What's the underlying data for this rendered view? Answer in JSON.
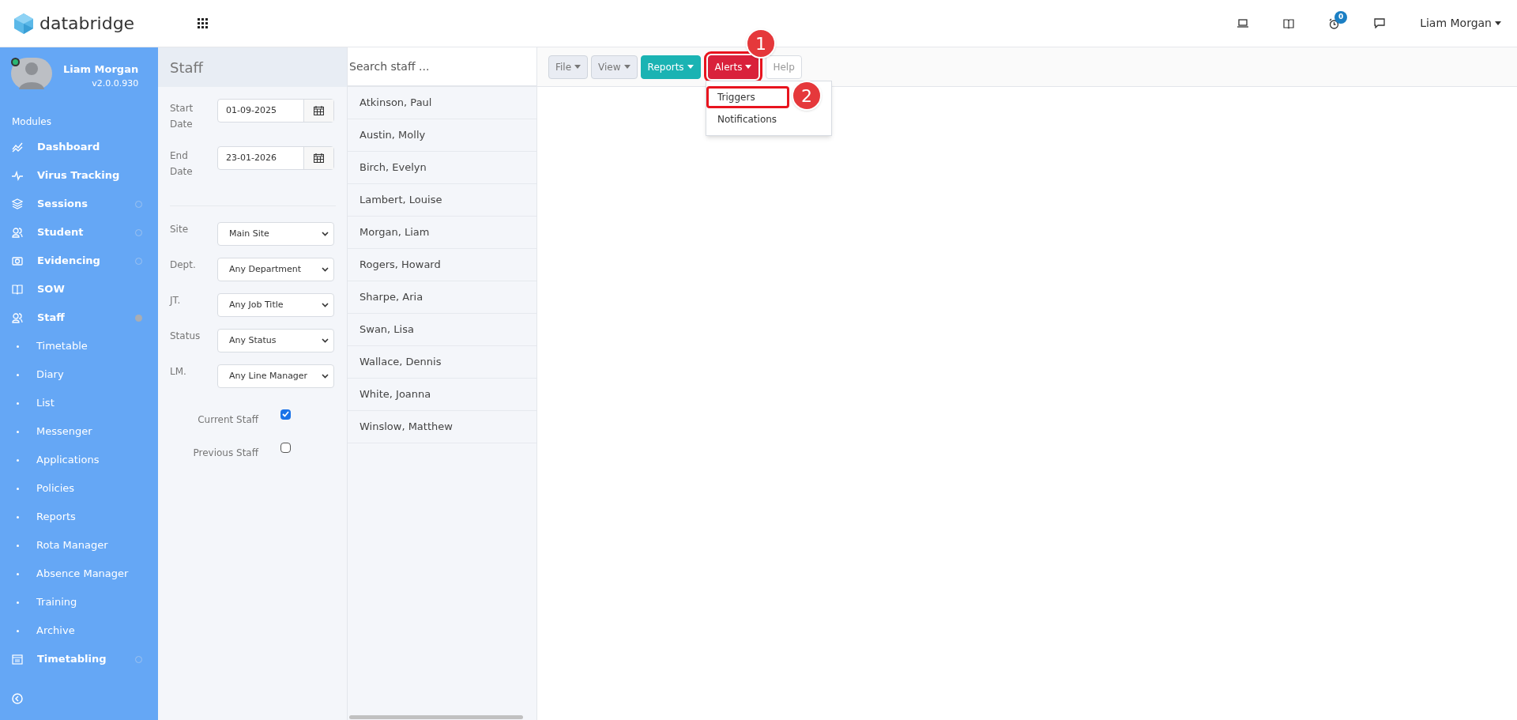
{
  "app": {
    "name": "databridge"
  },
  "topbar": {
    "notifications_count": "0",
    "user": "Liam Morgan"
  },
  "profile": {
    "name": "Liam Morgan",
    "version": "v2.0.0.930",
    "online": true
  },
  "sidebar": {
    "heading": "Modules",
    "items": [
      {
        "label": "Dashboard"
      },
      {
        "label": "Virus Tracking"
      },
      {
        "label": "Sessions",
        "expanded": false
      },
      {
        "label": "Student",
        "expanded": false
      },
      {
        "label": "Evidencing",
        "expanded": false
      },
      {
        "label": "SOW"
      },
      {
        "label": "Staff",
        "expanded": true,
        "children": [
          {
            "label": "Timetable"
          },
          {
            "label": "Diary"
          },
          {
            "label": "List"
          },
          {
            "label": "Messenger"
          },
          {
            "label": "Applications"
          },
          {
            "label": "Policies"
          },
          {
            "label": "Reports"
          },
          {
            "label": "Rota Manager"
          },
          {
            "label": "Absence Manager"
          },
          {
            "label": "Training"
          },
          {
            "label": "Archive"
          }
        ]
      },
      {
        "label": "Timetabling",
        "expanded": false
      }
    ]
  },
  "filters": {
    "title": "Staff",
    "dates": [
      {
        "label": "Start Date",
        "value": "01-09-2025"
      },
      {
        "label": "End Date",
        "value": "23-01-2026"
      }
    ],
    "selects": [
      {
        "label": "Site",
        "value": "Main Site"
      },
      {
        "label": "Dept.",
        "value": "Any Department"
      },
      {
        "label": "JT.",
        "value": "Any Job Title"
      },
      {
        "label": "Status",
        "value": "Any Status"
      },
      {
        "label": "LM.",
        "value": "Any Line Manager"
      }
    ],
    "checkboxes": [
      {
        "label": "Current Staff",
        "checked": true
      },
      {
        "label": "Previous Staff",
        "checked": false
      }
    ]
  },
  "staff_list": {
    "search": {
      "placeholder": "Search staff ..."
    },
    "rows": [
      "Atkinson, Paul",
      "Austin, Molly",
      "Birch, Evelyn",
      "Lambert, Louise",
      "Morgan, Liam",
      "Rogers, Howard",
      "Sharpe, Aria",
      "Swan, Lisa",
      "Wallace, Dennis",
      "White, Joanna",
      "Winslow, Matthew"
    ]
  },
  "toolbar": {
    "buttons": [
      {
        "label": "File",
        "highlighted": false
      },
      {
        "label": "View",
        "highlighted": false
      },
      {
        "label": "Reports",
        "highlighted": false
      },
      {
        "label": "Alerts",
        "highlighted": true
      },
      {
        "label": "Help",
        "highlighted": false
      }
    ],
    "menu": [
      {
        "label": "Triggers",
        "highlighted": true
      },
      {
        "label": "Notifications",
        "highlighted": false
      }
    ]
  },
  "annotations": [
    {
      "number": "1"
    },
    {
      "number": "2"
    }
  ]
}
